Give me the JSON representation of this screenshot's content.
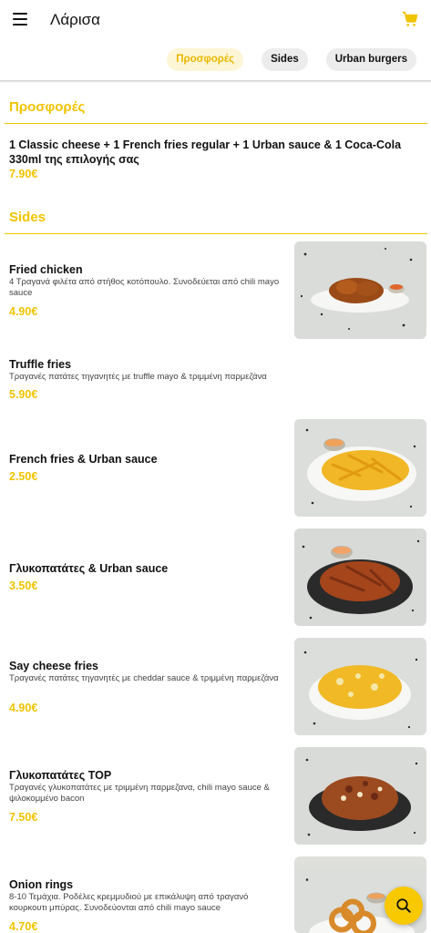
{
  "header": {
    "city": "Λάρισα"
  },
  "tabs": [
    {
      "label": "Προσφορές",
      "active": true
    },
    {
      "label": "Sides",
      "active": false
    },
    {
      "label": "Urban burgers",
      "active": false
    }
  ],
  "sections": {
    "offers": {
      "title": "Προσφορές",
      "items": [
        {
          "name": "1 Classic cheese + 1 French fries regular + 1 Urban sauce & 1 Coca-Cola 330ml της επιλογής σας",
          "price": "7.90€"
        }
      ]
    },
    "sides": {
      "title": "Sides",
      "items": [
        {
          "name": "Fried chicken",
          "description": "4 Τραγανά φιλέτα από στήθος κοτόπουλο. Συνοδεύεται από chili mayo sauce",
          "price": "4.90€"
        },
        {
          "name": "Truffle fries",
          "description": "Τραγανές πατάτες τηγανητές με truffle mayo & τριμμένη παρμεζάνα",
          "price": "5.90€"
        },
        {
          "name": "French fries & Urban sauce",
          "description": "",
          "price": "2.50€"
        },
        {
          "name": "Γλυκοπατάτες & Urban sauce",
          "description": "",
          "price": "3.50€"
        },
        {
          "name": "Say cheese fries",
          "description": "Τραγανές πατάτες τηγανητές με cheddar sauce & τριμμένη παρμεζάνα",
          "price": "4.90€"
        },
        {
          "name": "Γλυκοπατάτες TOP",
          "description": "Τραγανές γλυκοπατάτες με τριμμένη παρμεζανα, chili mayo sauce & ψιλοκομμένο bacon",
          "price": "7.50€"
        },
        {
          "name": "Onion rings",
          "description": "8-10 Τεμάχια. Ροδέλες κρεμμυδιού με επικάλυψη από τραγανό κουρκουτι μπύρας. Συνοδεύονται από chili mayo sauce",
          "price": "4.70€"
        }
      ]
    }
  },
  "colors": {
    "accent": "#f1c400",
    "tab_bg": "#ececec",
    "active_tab_bg": "#fdf6d6"
  },
  "icons": [
    "menu-icon",
    "cart-icon",
    "search-icon"
  ]
}
